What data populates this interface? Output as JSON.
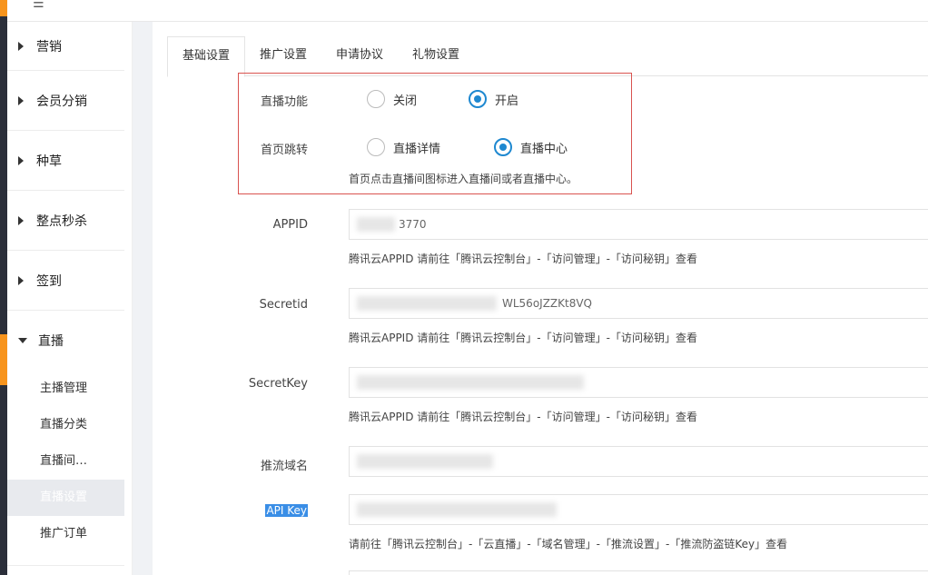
{
  "topbar": {
    "menu_glyph": "☰"
  },
  "sidebar": {
    "groups": [
      {
        "label": "营销"
      },
      {
        "label": "会员分销"
      },
      {
        "label": "种草"
      },
      {
        "label": "整点秒杀"
      },
      {
        "label": "签到"
      },
      {
        "label": "直播"
      }
    ],
    "live_sub": [
      {
        "label": "主播管理"
      },
      {
        "label": "直播分类"
      },
      {
        "label": "直播间…"
      },
      {
        "label": "直播设置"
      },
      {
        "label": "推广订单"
      }
    ]
  },
  "tabs": [
    {
      "label": "基础设置"
    },
    {
      "label": "推广设置"
    },
    {
      "label": "申请协议"
    },
    {
      "label": "礼物设置"
    }
  ],
  "form": {
    "live_function": {
      "label": "直播功能",
      "options": [
        {
          "label": "关闭"
        },
        {
          "label": "开启"
        }
      ],
      "selected": "开启"
    },
    "home_jump": {
      "label": "首页跳转",
      "options": [
        {
          "label": "直播详情"
        },
        {
          "label": "直播中心"
        }
      ],
      "selected": "直播中心",
      "hint": "首页点击直播间图标进入直播间或者直播中心。"
    },
    "appid": {
      "label": "APPID",
      "value": "3770",
      "hint": "腾讯云APPID 请前往「腾讯云控制台」-「访问管理」-「访问秘钥」查看"
    },
    "secretid": {
      "label": "Secretid",
      "value": "WL56oJZZKt8VQ",
      "hint": "腾讯云APPID 请前往「腾讯云控制台」-「访问管理」-「访问秘钥」查看"
    },
    "secretkey": {
      "label": "SecretKey",
      "value": "",
      "hint": "腾讯云APPID 请前往「腾讯云控制台」-「访问管理」-「访问秘钥」查看"
    },
    "push_domain": {
      "label": "推流域名",
      "value": ""
    },
    "api_key": {
      "label": "API Key",
      "value": "",
      "hint": "请前往「腾讯云控制台」-「云直播」-「域名管理」-「推流设置」-「推流防盗链Key」查看"
    }
  },
  "colors": {
    "accent": "#1e88d0",
    "highlight_border": "#d9534f",
    "sidebar_accent": "#f7941d"
  }
}
